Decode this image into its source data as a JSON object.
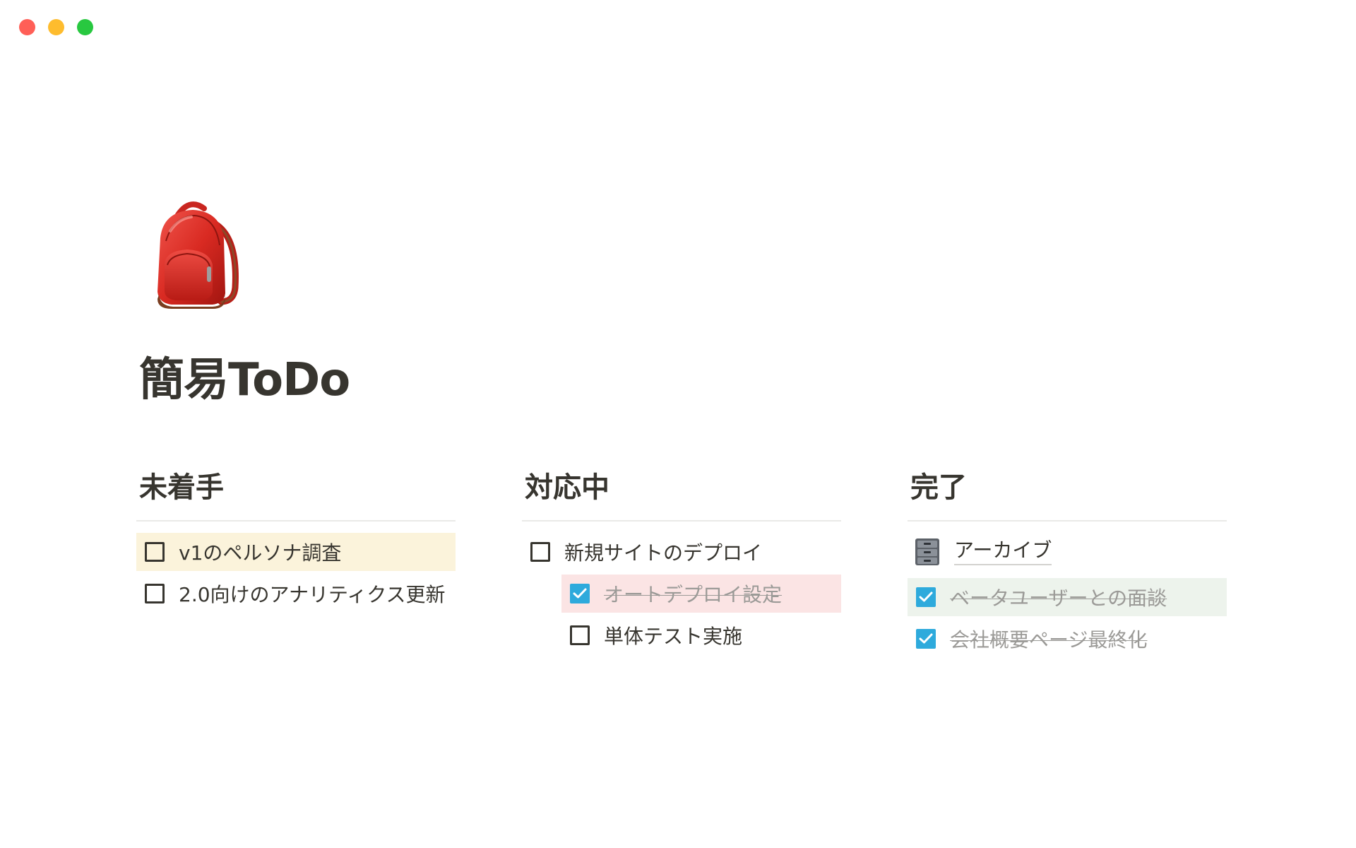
{
  "window": {
    "traffic_lights": [
      {
        "name": "close",
        "color": "#ff5f57"
      },
      {
        "name": "minimize",
        "color": "#febc2e"
      },
      {
        "name": "zoom",
        "color": "#28c840"
      }
    ]
  },
  "page": {
    "icon": "backpack-icon",
    "title": "簡易ToDo"
  },
  "columns": [
    {
      "heading": "未着手",
      "items": [
        {
          "text": "v1のペルソナ調査",
          "checked": false,
          "highlight": "#fbf3db"
        },
        {
          "text": "2.0向けのアナリティクス更新",
          "checked": false
        }
      ]
    },
    {
      "heading": "対応中",
      "items": [
        {
          "text": "新規サイトのデプロイ",
          "checked": false
        },
        {
          "text": "オートデプロイ設定",
          "checked": true,
          "indent": true,
          "highlight": "#fbe4e4"
        },
        {
          "text": "単体テスト実施",
          "checked": false,
          "indent": true
        }
      ]
    },
    {
      "heading": "完了",
      "link": {
        "text": "アーカイブ",
        "icon": "file-cabinet-icon"
      },
      "items": [
        {
          "text": "ベータユーザーとの面談",
          "checked": true,
          "highlight": "#edf3ec"
        },
        {
          "text": "会社概要ページ最終化",
          "checked": true
        }
      ]
    }
  ],
  "colors": {
    "text": "#37352f",
    "checkbox_checked": "#2eaadc",
    "done_text": "#9b9a97"
  }
}
